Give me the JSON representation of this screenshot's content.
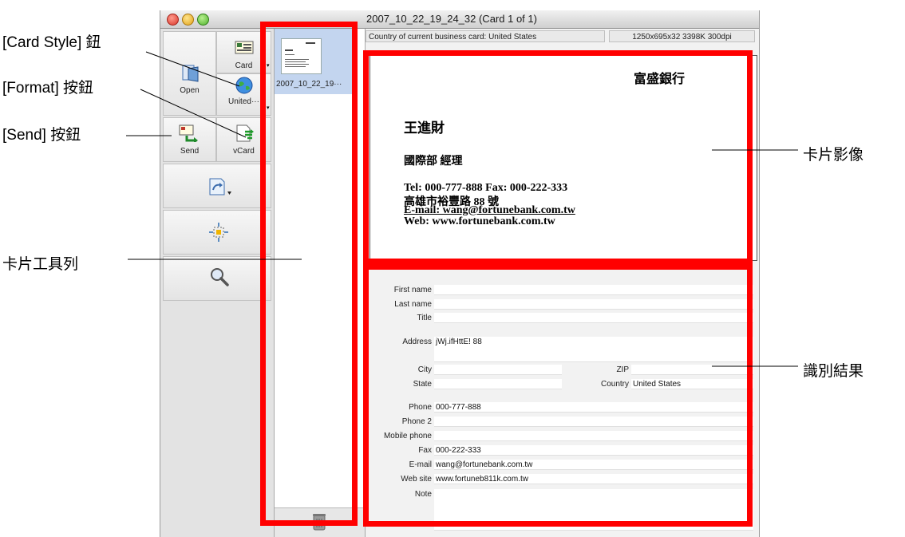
{
  "window": {
    "title": "2007_10_22_19_24_32 (Card 1 of 1)"
  },
  "toolbar": {
    "open_label": "Open",
    "card_label": "Card",
    "country_label": "United···",
    "send_label": "Send",
    "vcard_label": "vCard"
  },
  "thumbnails": [
    {
      "label": "2007_10_22_19···"
    }
  ],
  "status": {
    "country": "Country of current business card: United States",
    "resolution": "1250x695x32  3398K  300dpi"
  },
  "card": {
    "company": "富盛銀行",
    "name": "王進財",
    "dept": "國際部  經理",
    "tel_line": "Tel: 000-777-888   Fax: 000-222-333",
    "address_line": "高雄市裕豐路 88 號",
    "email_line": "E-mail: wang@fortunebank.com.tw",
    "web_line": "Web: www.fortunebank.com.tw"
  },
  "form": {
    "first_name_label": "First name",
    "last_name_label": "Last name",
    "title_label": "Title",
    "address_label": "Address",
    "address_value": "jWj.ifHttE!  88",
    "city_label": "City",
    "zip_label": "ZIP",
    "state_label": "State",
    "country_label": "Country",
    "country_value": "United States",
    "phone_label": "Phone",
    "phone_value": "000-777-888",
    "phone2_label": "Phone 2",
    "mobile_label": "Mobile phone",
    "fax_label": "Fax",
    "fax_value": "000-222-333",
    "email_label": "E-mail",
    "email_value": "wang@fortunebank.com.tw",
    "website_label": "Web site",
    "website_value": "www.fortuneb811k.com.tw",
    "note_label": "Note"
  },
  "annotations": {
    "card_style": "[Card Style] 鈕",
    "format": "[Format] 按鈕",
    "send": "[Send] 按鈕",
    "toolbar": "卡片工具列",
    "card_image": "卡片影像",
    "recognition": "識別結果"
  },
  "colors": {
    "highlight": "#ff0000",
    "selection": "#c3d5ef"
  },
  "icons": [
    "open-icon",
    "card-style-icon",
    "globe-icon",
    "send-icon",
    "vcard-icon",
    "rotate-icon",
    "crop-icon",
    "magnifier-icon",
    "trash-icon"
  ]
}
